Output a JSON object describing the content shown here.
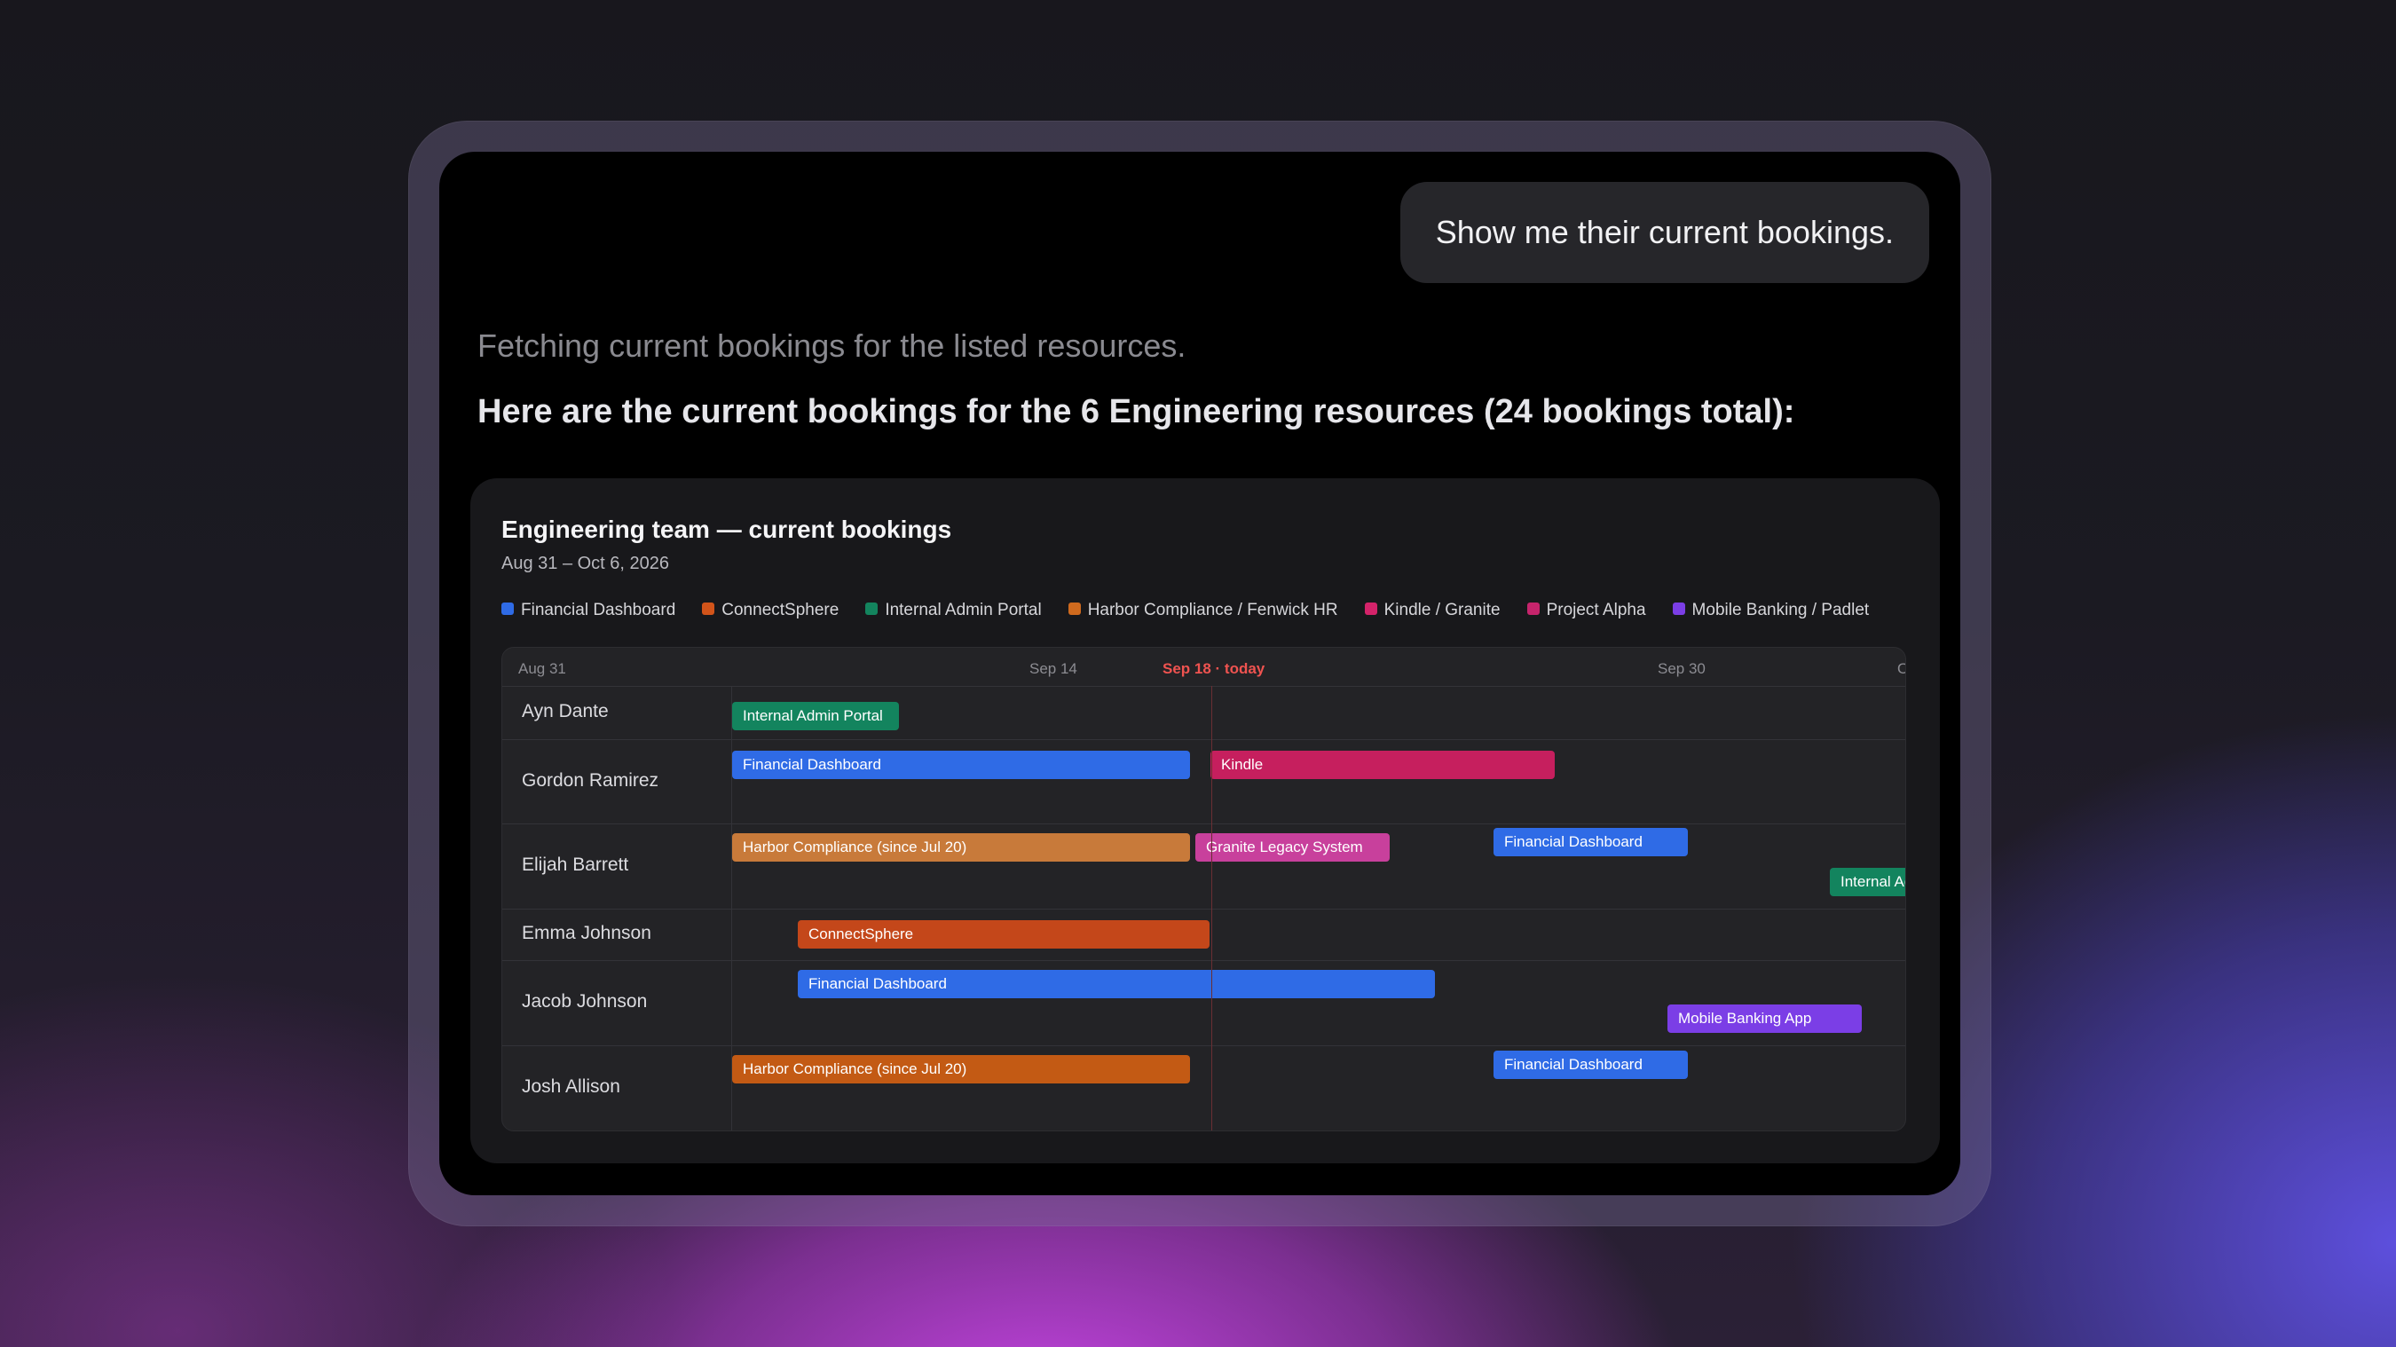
{
  "user_message": "Show me their current bookings.",
  "assistant": {
    "status": "Fetching current bookings for the listed resources.",
    "heading": "Here are the current bookings for the 6 Engineering resources (24 bookings total):"
  },
  "card": {
    "title": "Engineering team — current bookings",
    "subtitle": "Aug 31 – Oct 6, 2026",
    "legend": [
      {
        "label": "Financial Dashboard",
        "color": "#2f6be6"
      },
      {
        "label": "ConnectSphere",
        "color": "#d2541a"
      },
      {
        "label": "Internal Admin Portal",
        "color": "#13845e"
      },
      {
        "label": "Harbor Compliance / Fenwick HR",
        "color": "#cf6a1e"
      },
      {
        "label": "Kindle / Granite",
        "color": "#d4236a"
      },
      {
        "label": "Project Alpha",
        "color": "#c6246c"
      },
      {
        "label": "Mobile Banking / Padlet",
        "color": "#7b3ee6"
      }
    ],
    "axis": {
      "ticks": [
        "Aug 31",
        "Sep 14",
        "Sep 18 · today",
        "Sep 30",
        "O"
      ]
    },
    "rows": [
      {
        "name": "Ayn Dante",
        "bookings": [
          {
            "label": "Internal Admin Portal",
            "color": "#13845e"
          }
        ]
      },
      {
        "name": "Gordon Ramirez",
        "bookings": [
          {
            "label": "Financial Dashboard",
            "color": "#2f6be6"
          },
          {
            "label": "Kindle",
            "color": "#c61f5e"
          }
        ]
      },
      {
        "name": "Elijah Barrett",
        "bookings": [
          {
            "label": "Harbor Compliance (since Jul 20)",
            "color": "#c87a3a"
          },
          {
            "label": "Granite Legacy System",
            "color": "#c8409c"
          },
          {
            "label": "Financial Dashboard",
            "color": "#2f6be6"
          },
          {
            "label": "Internal Admin Portal",
            "color": "#13845e"
          }
        ]
      },
      {
        "name": "Emma Johnson",
        "bookings": [
          {
            "label": "ConnectSphere",
            "color": "#c4471a"
          }
        ]
      },
      {
        "name": "Jacob Johnson",
        "bookings": [
          {
            "label": "Financial Dashboard",
            "color": "#2f6be6"
          },
          {
            "label": "Mobile Banking App",
            "color": "#7b3ee6"
          }
        ]
      },
      {
        "name": "Josh Allison",
        "bookings": [
          {
            "label": "Harbor Compliance (since Jul 20)",
            "color": "#c35a14"
          },
          {
            "label": "Financial Dashboard",
            "color": "#2f6be6"
          }
        ]
      }
    ]
  }
}
